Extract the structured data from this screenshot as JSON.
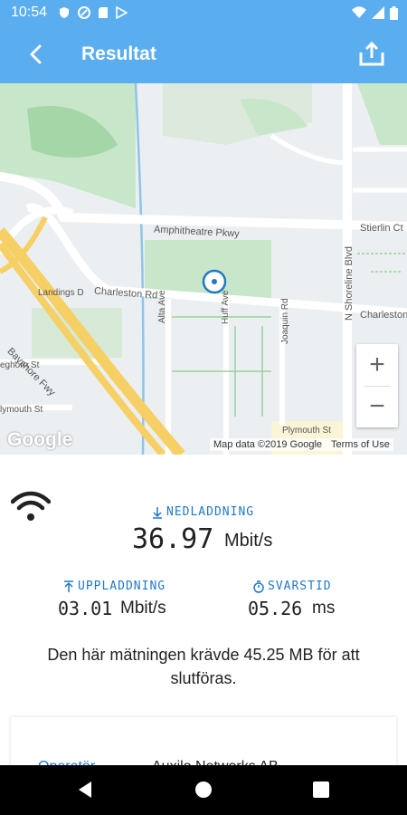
{
  "status_bar": {
    "time": "10:54",
    "left_icons": [
      "shield-icon",
      "vpn-icon",
      "sd-card-icon",
      "play-store-icon"
    ],
    "right_icons": [
      "wifi-icon",
      "signal-icon",
      "battery-icon"
    ]
  },
  "app_bar": {
    "title": "Resultat",
    "back_icon": "arrow-back-icon",
    "share_icon": "share-upload-icon",
    "color": "#5aaef0"
  },
  "map": {
    "labels": {
      "amphitheatre": "Amphitheatre Pkwy",
      "stierlin": "Stierlin Ct",
      "charleston_left": "Charleston Rd",
      "charleston_right": "Charleston",
      "landings": "Landings D",
      "bayshore": "Bayshore Fwy",
      "alta": "Alta Ave",
      "huff": "Huff Ave",
      "joaquin": "Joaquin Rd",
      "shoreline": "N Shoreline Blvd",
      "leghorn": "eghorn St",
      "plymouth_left": "lymouth St",
      "plymouth_right": "Plymouth St"
    },
    "zoom_in": "+",
    "zoom_out": "−",
    "logo": "Google",
    "attribution": "Map data ©2019 Google",
    "terms": "Terms of Use"
  },
  "results": {
    "download_label": "NEDLADDNING",
    "download_value": "36.97",
    "download_unit": "Mbit/s",
    "upload_label": "UPPLADDNING",
    "upload_value": "03.01",
    "upload_unit": "Mbit/s",
    "latency_label": "SVARSTID",
    "latency_value": "05.26",
    "latency_unit": "ms",
    "note": "Den här mätningen krävde 45.25 MB för att slutföras.",
    "accent": "#1f78c8"
  },
  "details": {
    "operator_key": "Operatör",
    "operator_value": "Auxilo Networks AB"
  },
  "nav": {
    "back": "nav-back-icon",
    "home": "nav-home-icon",
    "recents": "nav-recents-icon"
  }
}
